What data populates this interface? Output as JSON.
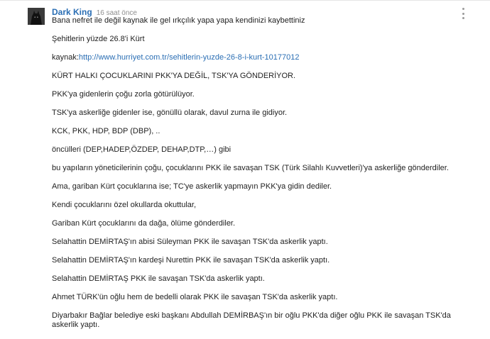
{
  "comment": {
    "author": "Dark King",
    "timestamp": "16 saat önce",
    "avatar_icon": "batman-avatar",
    "menu_icon": "more-vert-icon",
    "accent_color": "#2a6eb4",
    "paragraphs": [
      "Bana nefret ile değil kaynak ile gel ırkçılık yapa yapa kendinizi kaybettiniz",
      "Şehitlerin yüzde 26.8'i Kürt",
      "KÜRT HALKI ÇOCUKLARINI PKK'YA DEĞİL, TSK'YA GÖNDERİYOR.",
      "PKK'ya gidenlerin çoğu zorla götürülüyor.",
      "TSK'ya askerliğe gidenler ise, gönüllü olarak, davul zurna ile  gidiyor.",
      "KCK, PKK, HDP, BDP (DBP), ..",
      "öncülleri (DEP,HADEP,ÖZDEP, DEHAP,DTP,…) gibi",
      "bu yapıların yöneticilerinin çoğu, çocuklarını PKK ile savaşan TSK (Türk Silahlı Kuvvetleri)'ya askerliğe gönderdiler.",
      "Ama, gariban Kürt çocuklarına ise; TC'ye askerlik yapmayın PKK'ya gidin dediler.",
      "Kendi çocuklarını özel okullarda okuttular,",
      "Gariban Kürt çocuklarını da dağa, ölüme gönderdiler.",
      "Selahattin DEMİRTAŞ'ın abisi Süleyman PKK ile savaşan TSK'da askerlik yaptı.",
      "Selahattin DEMİRTAŞ'ın kardeşi Nurettin PKK ile savaşan TSK'da askerlik yaptı.",
      "Selahattin DEMİRTAŞ PKK ile savaşan TSK'da askerlik yaptı.",
      "Ahmet TÜRK'ün oğlu hem de bedelli olarak PKK ile savaşan TSK'da askerlik yaptı.",
      "Diyarbakır Bağlar belediye eski başkanı Abdullah DEMİRBAŞ'ın bir oğlu PKK'da diğer oğlu PKK ile savaşan TSK'da askerlik yaptı."
    ],
    "source_label": "kaynak:",
    "source_url": "http://www.hurriyet.com.tr/sehitlerin-yuzde-26-8-i-kurt-10177012"
  }
}
